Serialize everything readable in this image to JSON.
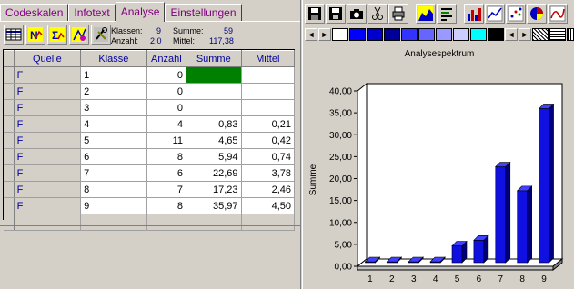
{
  "tabs": [
    {
      "label": "Codeskalen"
    },
    {
      "label": "Infotext"
    },
    {
      "label": "Analyse"
    },
    {
      "label": "Einstellungen"
    }
  ],
  "stats": {
    "klassen_label": "Klassen:",
    "klassen_value": "9",
    "anzahl_label": "Anzahl:",
    "anzahl_value": "2,0",
    "summe_label": "Summe:",
    "summe_value": "59",
    "mittel_label": "Mittel:",
    "mittel_value": "117,38"
  },
  "table": {
    "headers": {
      "quelle": "Quelle",
      "klasse": "Klasse",
      "anzahl": "Anzahl",
      "summe": "Summe",
      "mittel": "Mittel"
    },
    "rows": [
      {
        "quelle": "F",
        "klasse": "1",
        "anzahl": "0",
        "summe": "",
        "mittel": ""
      },
      {
        "quelle": "F",
        "klasse": "2",
        "anzahl": "0",
        "summe": "",
        "mittel": ""
      },
      {
        "quelle": "F",
        "klasse": "3",
        "anzahl": "0",
        "summe": "",
        "mittel": ""
      },
      {
        "quelle": "F",
        "klasse": "4",
        "anzahl": "4",
        "summe": "0,83",
        "mittel": "0,21"
      },
      {
        "quelle": "F",
        "klasse": "5",
        "anzahl": "11",
        "summe": "4,65",
        "mittel": "0,42"
      },
      {
        "quelle": "F",
        "klasse": "6",
        "anzahl": "8",
        "summe": "5,94",
        "mittel": "0,74"
      },
      {
        "quelle": "F",
        "klasse": "7",
        "anzahl": "6",
        "summe": "22,69",
        "mittel": "3,78"
      },
      {
        "quelle": "F",
        "klasse": "8",
        "anzahl": "7",
        "summe": "17,23",
        "mittel": "2,46"
      },
      {
        "quelle": "F",
        "klasse": "9",
        "anzahl": "8",
        "summe": "35,97",
        "mittel": "4,50"
      }
    ]
  },
  "toolbar_icons": [
    "table-view-icon",
    "chart-n-icon",
    "sum-icon",
    "edit-icon",
    "tool-icon"
  ],
  "chart_toolbar_icons": [
    "save-icon",
    "save-as-icon",
    "camera-icon",
    "cut-icon",
    "print-icon",
    "area-chart-icon",
    "legend-icon",
    "bar-chart-icon",
    "line-chart-icon",
    "scatter-chart-icon",
    "pie-chart-icon",
    "curve-chart-icon"
  ],
  "pattern_colors": [
    "#ffffff",
    "#0000ff",
    "#0000cc",
    "#000099",
    "#3333ff",
    "#6666ff",
    "#9999ff",
    "#ccccff",
    "#00ffff",
    "#000000"
  ],
  "colors": {
    "bar": "#1010e0",
    "bar_side": "#00007a",
    "bar_top": "#4040ff",
    "accent": "#800080"
  },
  "chart_data": {
    "type": "bar",
    "title": "Analysespektrum",
    "xlabel": "",
    "ylabel": "Summe",
    "categories": [
      "1",
      "2",
      "3",
      "4",
      "5",
      "6",
      "7",
      "8",
      "9"
    ],
    "values": [
      0,
      0,
      0,
      0.83,
      4.65,
      5.94,
      22.69,
      17.23,
      35.97
    ],
    "ylim": [
      0,
      40
    ],
    "yticks": [
      "0,00",
      "5,00",
      "10,00",
      "15,00",
      "20,00",
      "25,00",
      "30,00",
      "35,00",
      "40,00"
    ],
    "three_d": true,
    "grid": false
  }
}
